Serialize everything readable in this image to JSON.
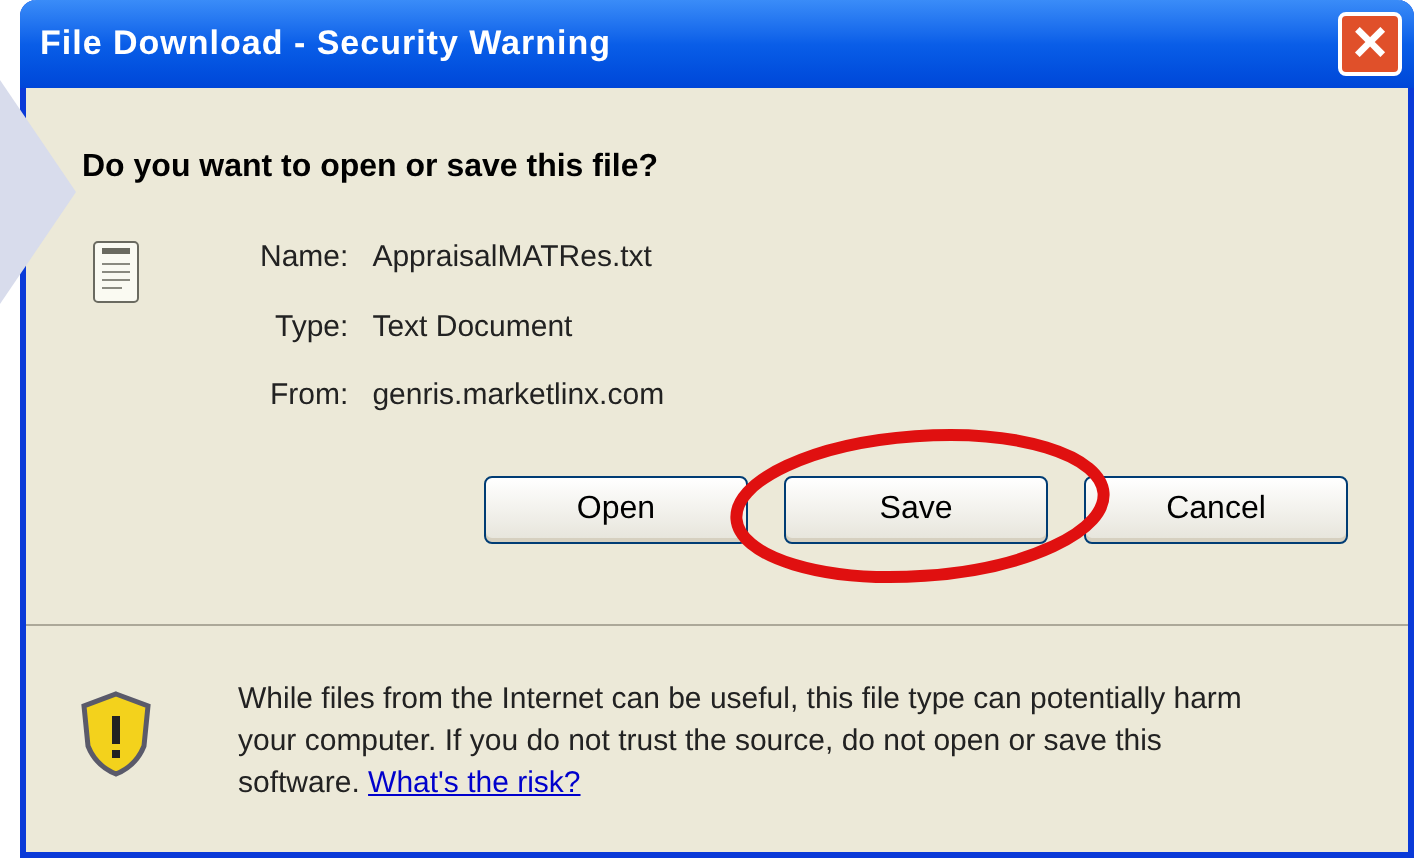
{
  "window": {
    "title": "File Download - Security Warning",
    "close": "×"
  },
  "question": "Do you want to open or save this file?",
  "file_details": [
    {
      "label": "Name:",
      "value": "AppraisalMATRes.txt"
    },
    {
      "label": "Type:",
      "value": "Text Document"
    },
    {
      "label": "From:",
      "value": "genris.marketlinx.com"
    }
  ],
  "buttons": [
    "Open",
    "Save",
    "Cancel"
  ],
  "warning": {
    "text": "While files from the Internet can be useful, this file type can potentially harm your computer. If you do not trust the source, do not open or save this software.",
    "link": "What's the risk?"
  }
}
